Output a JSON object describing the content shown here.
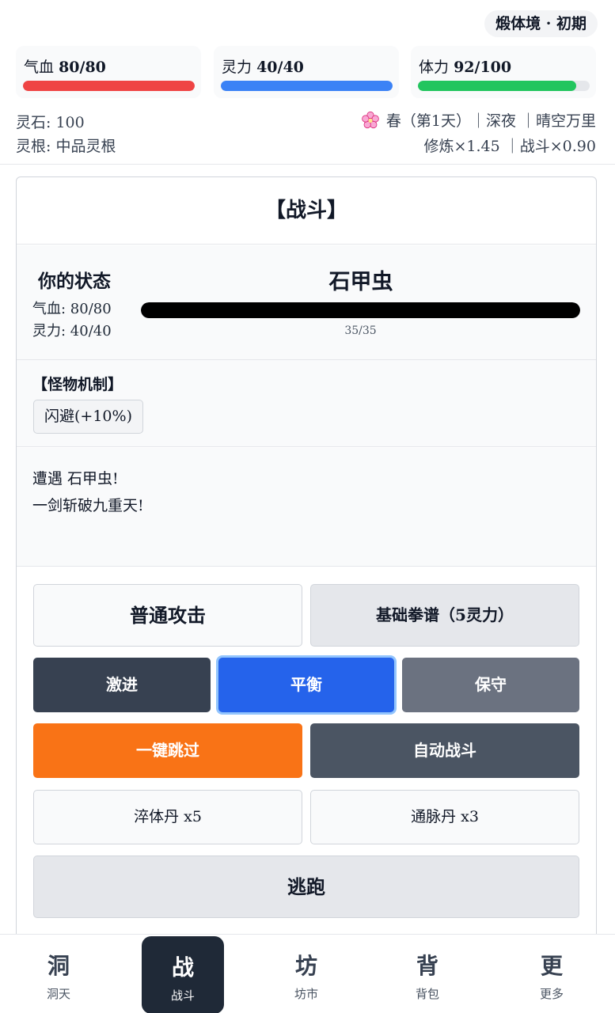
{
  "header": {
    "realm": "煅体境 · 初期",
    "stats": [
      {
        "label": "气血",
        "value": "80/80",
        "current": 80,
        "max": 80,
        "color": "#ef4444"
      },
      {
        "label": "灵力",
        "value": "40/40",
        "current": 40,
        "max": 40,
        "color": "#3b82f6"
      },
      {
        "label": "体力",
        "value": "92/100",
        "current": 92,
        "max": 100,
        "color": "#22c55e"
      }
    ],
    "spirit_stone": "灵石: 100",
    "spirit_root": "灵根: 中品灵根",
    "season_line": "春（第1天）｜深夜 ｜晴空万里",
    "multipliers": "修炼×1.45 ｜战斗×0.90"
  },
  "battle": {
    "title": "【战斗】",
    "you": {
      "title": "你的状态",
      "hp": "气血: 80/80",
      "mp": "灵力: 40/40"
    },
    "enemy": {
      "name": "石甲虫",
      "hp_text": "35/35",
      "hp_current": 35,
      "hp_max": 35
    },
    "mechanic_title": "【怪物机制】",
    "mechanic_tag": "闪避(+10%)",
    "log": [
      "遭遇 石甲虫!",
      "一剑斩破九重天!"
    ],
    "buttons": {
      "attack": "普通攻击",
      "skill": "基础拳谱（5灵力）",
      "aggressive": "激进",
      "balanced": "平衡",
      "defensive": "保守",
      "skip": "一键跳过",
      "auto": "自动战斗",
      "pill1": "淬体丹 x5",
      "pill2": "通脉丹 x3",
      "flee": "逃跑"
    }
  },
  "nav": [
    {
      "glyph": "洞",
      "label": "洞天"
    },
    {
      "glyph": "战",
      "label": "战斗"
    },
    {
      "glyph": "坊",
      "label": "坊市"
    },
    {
      "glyph": "背",
      "label": "背包"
    },
    {
      "glyph": "更",
      "label": "更多"
    }
  ]
}
